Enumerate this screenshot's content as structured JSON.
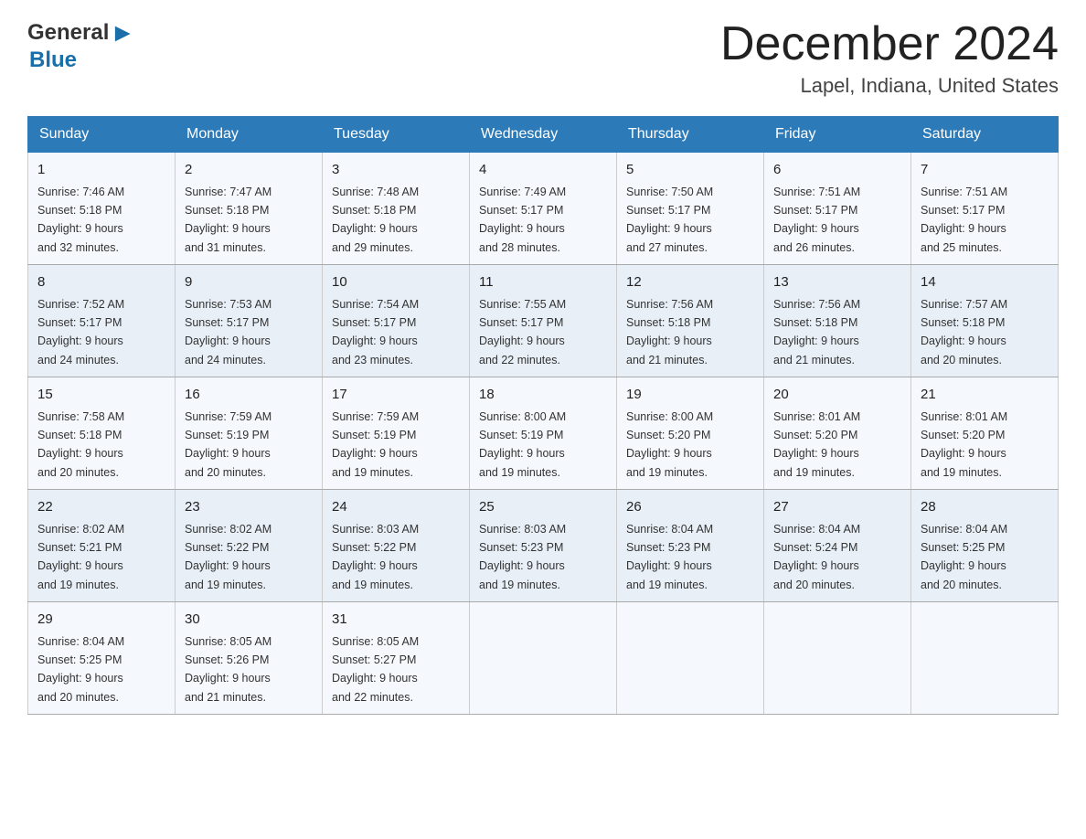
{
  "header": {
    "logo": {
      "general": "General",
      "blue": "Blue"
    },
    "month_title": "December 2024",
    "location": "Lapel, Indiana, United States"
  },
  "weekdays": [
    "Sunday",
    "Monday",
    "Tuesday",
    "Wednesday",
    "Thursday",
    "Friday",
    "Saturday"
  ],
  "weeks": [
    [
      {
        "day": "1",
        "sunrise": "7:46 AM",
        "sunset": "5:18 PM",
        "daylight": "9 hours and 32 minutes."
      },
      {
        "day": "2",
        "sunrise": "7:47 AM",
        "sunset": "5:18 PM",
        "daylight": "9 hours and 31 minutes."
      },
      {
        "day": "3",
        "sunrise": "7:48 AM",
        "sunset": "5:18 PM",
        "daylight": "9 hours and 29 minutes."
      },
      {
        "day": "4",
        "sunrise": "7:49 AM",
        "sunset": "5:17 PM",
        "daylight": "9 hours and 28 minutes."
      },
      {
        "day": "5",
        "sunrise": "7:50 AM",
        "sunset": "5:17 PM",
        "daylight": "9 hours and 27 minutes."
      },
      {
        "day": "6",
        "sunrise": "7:51 AM",
        "sunset": "5:17 PM",
        "daylight": "9 hours and 26 minutes."
      },
      {
        "day": "7",
        "sunrise": "7:51 AM",
        "sunset": "5:17 PM",
        "daylight": "9 hours and 25 minutes."
      }
    ],
    [
      {
        "day": "8",
        "sunrise": "7:52 AM",
        "sunset": "5:17 PM",
        "daylight": "9 hours and 24 minutes."
      },
      {
        "day": "9",
        "sunrise": "7:53 AM",
        "sunset": "5:17 PM",
        "daylight": "9 hours and 24 minutes."
      },
      {
        "day": "10",
        "sunrise": "7:54 AM",
        "sunset": "5:17 PM",
        "daylight": "9 hours and 23 minutes."
      },
      {
        "day": "11",
        "sunrise": "7:55 AM",
        "sunset": "5:17 PM",
        "daylight": "9 hours and 22 minutes."
      },
      {
        "day": "12",
        "sunrise": "7:56 AM",
        "sunset": "5:18 PM",
        "daylight": "9 hours and 21 minutes."
      },
      {
        "day": "13",
        "sunrise": "7:56 AM",
        "sunset": "5:18 PM",
        "daylight": "9 hours and 21 minutes."
      },
      {
        "day": "14",
        "sunrise": "7:57 AM",
        "sunset": "5:18 PM",
        "daylight": "9 hours and 20 minutes."
      }
    ],
    [
      {
        "day": "15",
        "sunrise": "7:58 AM",
        "sunset": "5:18 PM",
        "daylight": "9 hours and 20 minutes."
      },
      {
        "day": "16",
        "sunrise": "7:59 AM",
        "sunset": "5:19 PM",
        "daylight": "9 hours and 20 minutes."
      },
      {
        "day": "17",
        "sunrise": "7:59 AM",
        "sunset": "5:19 PM",
        "daylight": "9 hours and 19 minutes."
      },
      {
        "day": "18",
        "sunrise": "8:00 AM",
        "sunset": "5:19 PM",
        "daylight": "9 hours and 19 minutes."
      },
      {
        "day": "19",
        "sunrise": "8:00 AM",
        "sunset": "5:20 PM",
        "daylight": "9 hours and 19 minutes."
      },
      {
        "day": "20",
        "sunrise": "8:01 AM",
        "sunset": "5:20 PM",
        "daylight": "9 hours and 19 minutes."
      },
      {
        "day": "21",
        "sunrise": "8:01 AM",
        "sunset": "5:20 PM",
        "daylight": "9 hours and 19 minutes."
      }
    ],
    [
      {
        "day": "22",
        "sunrise": "8:02 AM",
        "sunset": "5:21 PM",
        "daylight": "9 hours and 19 minutes."
      },
      {
        "day": "23",
        "sunrise": "8:02 AM",
        "sunset": "5:22 PM",
        "daylight": "9 hours and 19 minutes."
      },
      {
        "day": "24",
        "sunrise": "8:03 AM",
        "sunset": "5:22 PM",
        "daylight": "9 hours and 19 minutes."
      },
      {
        "day": "25",
        "sunrise": "8:03 AM",
        "sunset": "5:23 PM",
        "daylight": "9 hours and 19 minutes."
      },
      {
        "day": "26",
        "sunrise": "8:04 AM",
        "sunset": "5:23 PM",
        "daylight": "9 hours and 19 minutes."
      },
      {
        "day": "27",
        "sunrise": "8:04 AM",
        "sunset": "5:24 PM",
        "daylight": "9 hours and 20 minutes."
      },
      {
        "day": "28",
        "sunrise": "8:04 AM",
        "sunset": "5:25 PM",
        "daylight": "9 hours and 20 minutes."
      }
    ],
    [
      {
        "day": "29",
        "sunrise": "8:04 AM",
        "sunset": "5:25 PM",
        "daylight": "9 hours and 20 minutes."
      },
      {
        "day": "30",
        "sunrise": "8:05 AM",
        "sunset": "5:26 PM",
        "daylight": "9 hours and 21 minutes."
      },
      {
        "day": "31",
        "sunrise": "8:05 AM",
        "sunset": "5:27 PM",
        "daylight": "9 hours and 22 minutes."
      },
      null,
      null,
      null,
      null
    ]
  ]
}
